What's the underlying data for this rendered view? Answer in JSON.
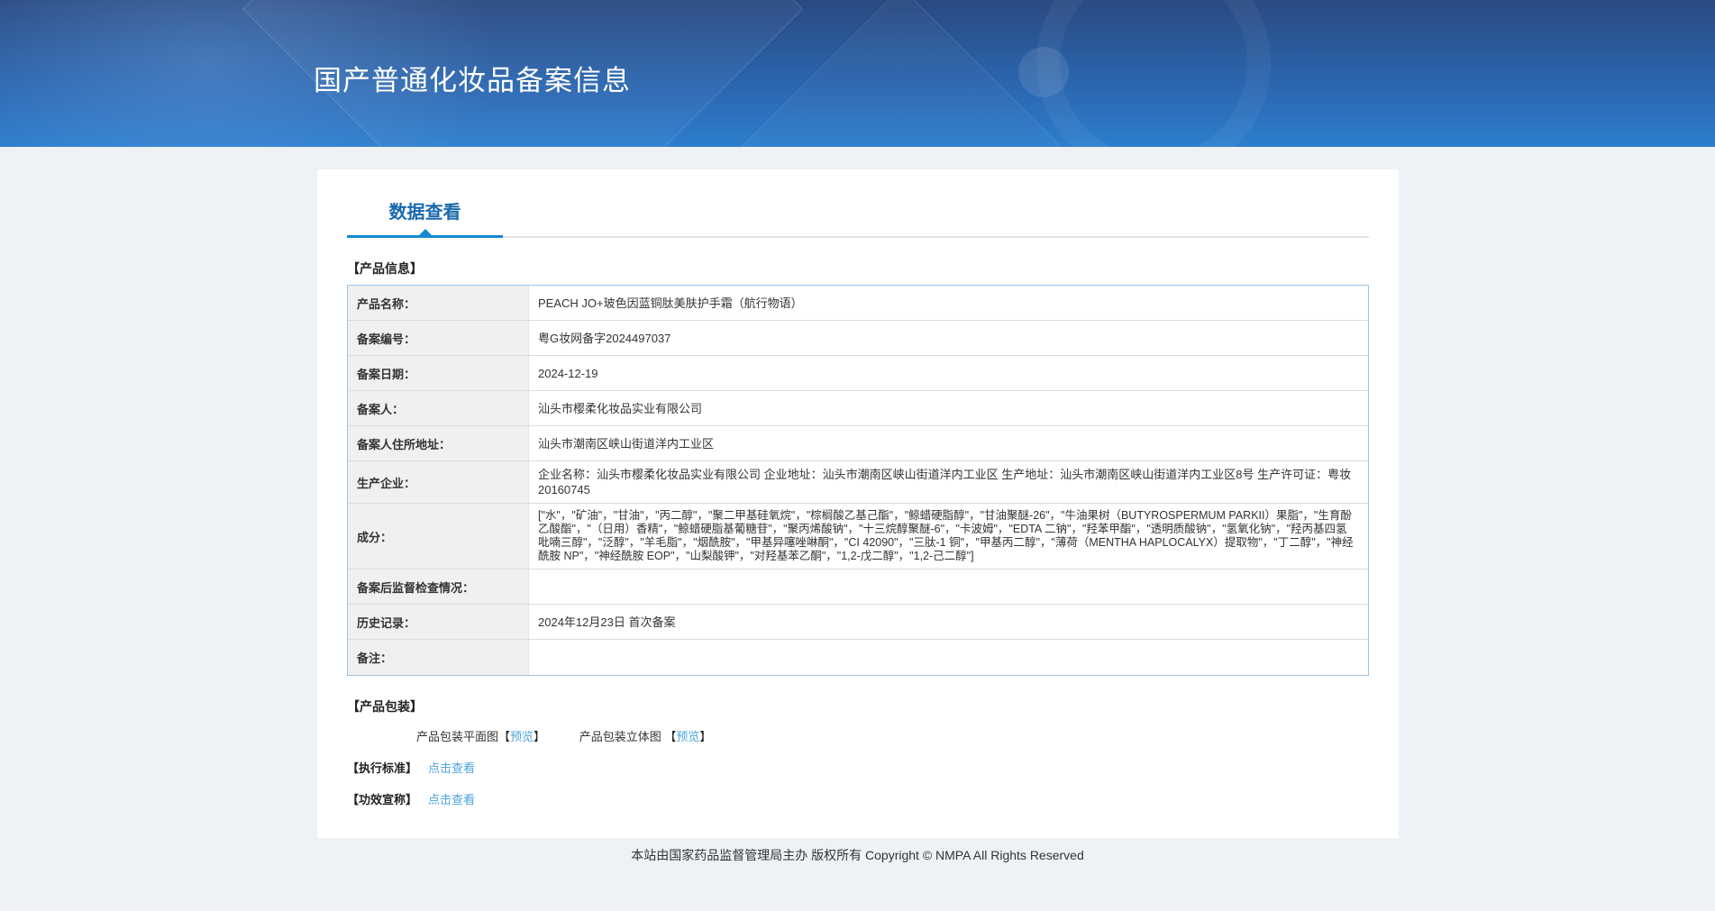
{
  "header": {
    "title": "国产普通化妆品备案信息"
  },
  "tabs": {
    "data_view": "数据查看"
  },
  "product_info": {
    "section_title": "【产品信息】",
    "rows": [
      {
        "label": "产品名称：",
        "value": "PEACH JO+玻色因蓝铜肽美肤护手霜（航行物语）"
      },
      {
        "label": "备案编号：",
        "value": "粤G妆网备字2024497037"
      },
      {
        "label": "备案日期：",
        "value": "2024-12-19"
      },
      {
        "label": "备案人：",
        "value": "汕头市樱柔化妆品实业有限公司"
      },
      {
        "label": "备案人住所地址：",
        "value": "汕头市潮南区峡山街道洋内工业区"
      },
      {
        "label": "生产企业：",
        "value": "企业名称：汕头市樱柔化妆品实业有限公司 企业地址：汕头市潮南区峡山街道洋内工业区 生产地址：汕头市潮南区峡山街道洋内工业区8号 生产许可证：粤妆20160745"
      },
      {
        "label": "成分：",
        "value": "[\"水\"，\"矿油\"，\"甘油\"，\"丙二醇\"，\"聚二甲基硅氧烷\"，\"棕榈酸乙基己酯\"，\"鲸蜡硬脂醇\"，\"甘油聚醚-26\"，\"牛油果树（BUTYROSPERMUM PARKII）果脂\"，\"生育酚乙酸酯\"，\"（日用）香精\"，\"鲸蜡硬脂基葡糖苷\"，\"聚丙烯酸钠\"，\"十三烷醇聚醚-6\"，\"卡波姆\"，\"EDTA 二钠\"，\"羟苯甲酯\"，\"透明质酸钠\"，\"氢氧化钠\"，\"羟丙基四氢吡喃三醇\"，\"泛醇\"，\"羊毛脂\"，\"烟酰胺\"，\"甲基异噻唑啉酮\"，\"CI 42090\"，\"三肽-1 铜\"，\"甲基丙二醇\"，\"薄荷（MENTHA HAPLOCALYX）提取物\"，\"丁二醇\"，\"神经酰胺 NP\"，\"神经酰胺 EOP\"，\"山梨酸钾\"，\"对羟基苯乙酮\"，\"1,2-戊二醇\"，\"1,2-己二醇\"]"
      },
      {
        "label": "备案后监督检查情况：",
        "value": ""
      },
      {
        "label": "历史记录：",
        "value": "2024年12月23日 首次备案"
      },
      {
        "label": "备注：",
        "value": ""
      }
    ]
  },
  "packaging": {
    "section_title": "【产品包装】",
    "flat_label": "产品包装平面图",
    "stereo_label": "产品包装立体图",
    "preview_link": "预览",
    "bracket_open": "【",
    "bracket_close": "】"
  },
  "standard": {
    "title": "【执行标准】",
    "link": "点击查看"
  },
  "efficacy": {
    "title": "【功效宣称】",
    "link": "点击查看"
  },
  "footer": {
    "text": "本站由国家药品监督管理局主办 版权所有 Copyright © NMPA All Rights Reserved"
  },
  "colors": {
    "banner_top": "#2a4a82",
    "banner_bottom": "#2c7ecd",
    "tab_blue": "#1a68ae",
    "tab_underline": "#1788d2",
    "link_blue": "#4da3dd",
    "table_border": "#9fc3e4",
    "label_bg": "#f0f0f0",
    "page_bg": "#eef1f6"
  }
}
